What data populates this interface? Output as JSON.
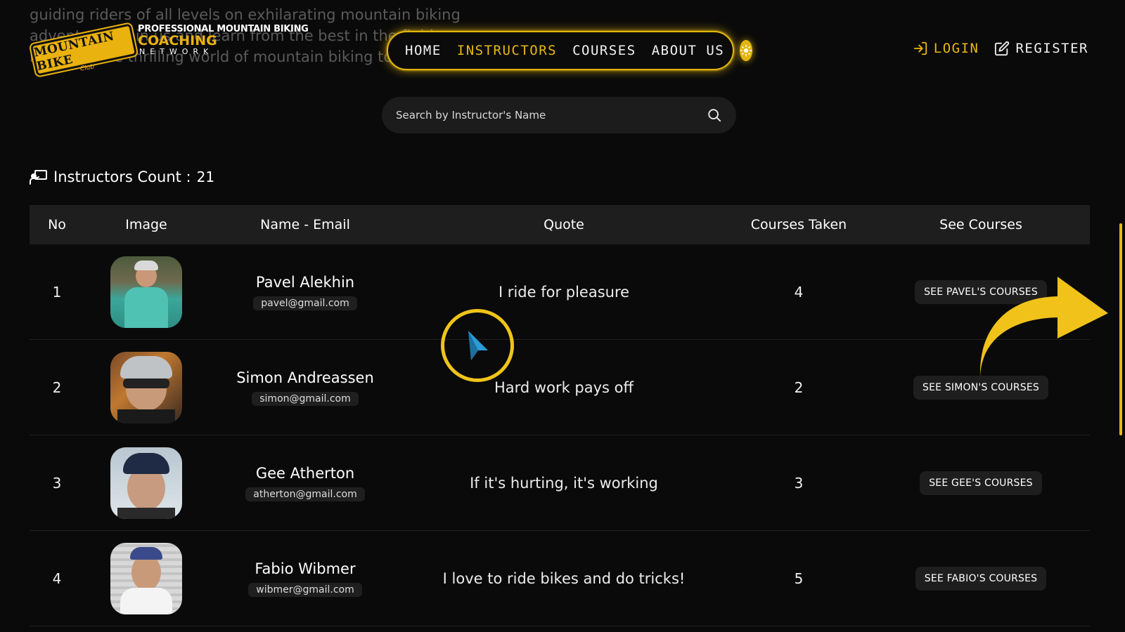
{
  "background_text": "guiding riders of all levels on exhilarating mountain biking adventures. Join us and learn from the best in the field as we navigate the thrilling world of mountain biking together.",
  "logo": {
    "badge": "MOUNTAIN BIKE",
    "club": "Club",
    "line1": "PROFESSIONAL MOUNTAIN BIKING",
    "line2": "COACHING",
    "line3": "NETWORK"
  },
  "nav": {
    "items": [
      {
        "label": "HOME",
        "active": false
      },
      {
        "label": "INSTRUCTORS",
        "active": true
      },
      {
        "label": "COURSES",
        "active": false
      },
      {
        "label": "ABOUT US",
        "active": false
      }
    ]
  },
  "auth": {
    "login": "LOGIN",
    "register": "REGISTER"
  },
  "search": {
    "placeholder": "Search by Instructor's Name",
    "value": ""
  },
  "count": {
    "label": "Instructors Count :",
    "value": "21"
  },
  "table": {
    "headers": [
      "No",
      "Image",
      "Name - Email",
      "Quote",
      "Courses Taken",
      "See Courses"
    ],
    "rows": [
      {
        "no": "1",
        "name": "Pavel Alekhin",
        "email": "pavel@gmail.com",
        "quote": "I ride for pleasure",
        "courses": "4",
        "button": "SEE PAVEL'S COURSES"
      },
      {
        "no": "2",
        "name": "Simon Andreassen",
        "email": "simon@gmail.com",
        "quote": "Hard work pays off",
        "courses": "2",
        "button": "SEE SIMON'S COURSES"
      },
      {
        "no": "3",
        "name": "Gee Atherton",
        "email": "atherton@gmail.com",
        "quote": "If it's hurting, it's working",
        "courses": "3",
        "button": "SEE GEE'S COURSES"
      },
      {
        "no": "4",
        "name": "Fabio Wibmer",
        "email": "wibmer@gmail.com",
        "quote": "I love to ride bikes and do tricks!",
        "courses": "5",
        "button": "SEE FABIO'S COURSES"
      }
    ]
  },
  "colors": {
    "accent": "#e8b90f",
    "background": "#0a0a0a",
    "header_row": "#1e1e1e"
  }
}
